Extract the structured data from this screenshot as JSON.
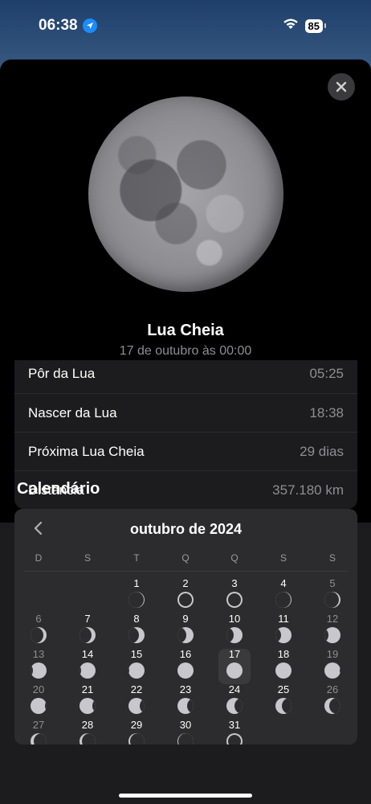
{
  "status_bar": {
    "time": "06:38",
    "battery": "85"
  },
  "moon_detail": {
    "phase_name": "Lua Cheia",
    "date": "17 de outubro às 00:00",
    "rows": [
      {
        "label": "Pôr da Lua",
        "value": "05:25"
      },
      {
        "label": "Nascer da Lua",
        "value": "18:38"
      },
      {
        "label": "Próxima Lua Cheia",
        "value": "29 dias"
      },
      {
        "label": "Distância",
        "value": "357.180 km"
      }
    ]
  },
  "calendar": {
    "section_title": "Calendário",
    "month": "outubro de 2024",
    "weekdays": [
      "D",
      "S",
      "T",
      "Q",
      "Q",
      "S",
      "S"
    ],
    "first_weekday_index": 2,
    "selected_day": 17,
    "days": [
      {
        "d": "1",
        "illum": 0.06
      },
      {
        "d": "2",
        "illum": 0.0
      },
      {
        "d": "3",
        "illum": 0.02
      },
      {
        "d": "4",
        "illum": 0.06
      },
      {
        "d": "5",
        "illum": 0.12
      },
      {
        "d": "6",
        "illum": 0.19
      },
      {
        "d": "7",
        "illum": 0.27
      },
      {
        "d": "8",
        "illum": 0.36
      },
      {
        "d": "9",
        "illum": 0.46
      },
      {
        "d": "10",
        "illum": 0.56
      },
      {
        "d": "11",
        "illum": 0.66
      },
      {
        "d": "12",
        "illum": 0.76
      },
      {
        "d": "13",
        "illum": 0.85
      },
      {
        "d": "14",
        "illum": 0.92
      },
      {
        "d": "15",
        "illum": 0.97
      },
      {
        "d": "16",
        "illum": 1.0
      },
      {
        "d": "17",
        "illum": 1.0
      },
      {
        "d": "18",
        "illum": 0.98
      },
      {
        "d": "19",
        "illum": 0.94
      },
      {
        "d": "20",
        "illum": 0.88
      },
      {
        "d": "21",
        "illum": 0.8
      },
      {
        "d": "22",
        "illum": 0.7
      },
      {
        "d": "23",
        "illum": 0.6
      },
      {
        "d": "24",
        "illum": 0.5
      },
      {
        "d": "25",
        "illum": 0.4
      },
      {
        "d": "26",
        "illum": 0.3
      },
      {
        "d": "27",
        "illum": 0.21
      },
      {
        "d": "28",
        "illum": 0.14
      },
      {
        "d": "29",
        "illum": 0.08
      },
      {
        "d": "30",
        "illum": 0.04
      },
      {
        "d": "31",
        "illum": 0.01
      }
    ]
  },
  "colors": {
    "accent": "#1a8cff",
    "sheet_bg": "#000000",
    "card_bg": "#1c1c1e",
    "calendar_bg": "#2c2c2e",
    "moon_lit": "#c8c8cc"
  },
  "icons": {
    "location": "location-arrow-icon",
    "wifi": "wifi-icon",
    "close": "close-icon",
    "prev": "chevron-left-icon"
  }
}
